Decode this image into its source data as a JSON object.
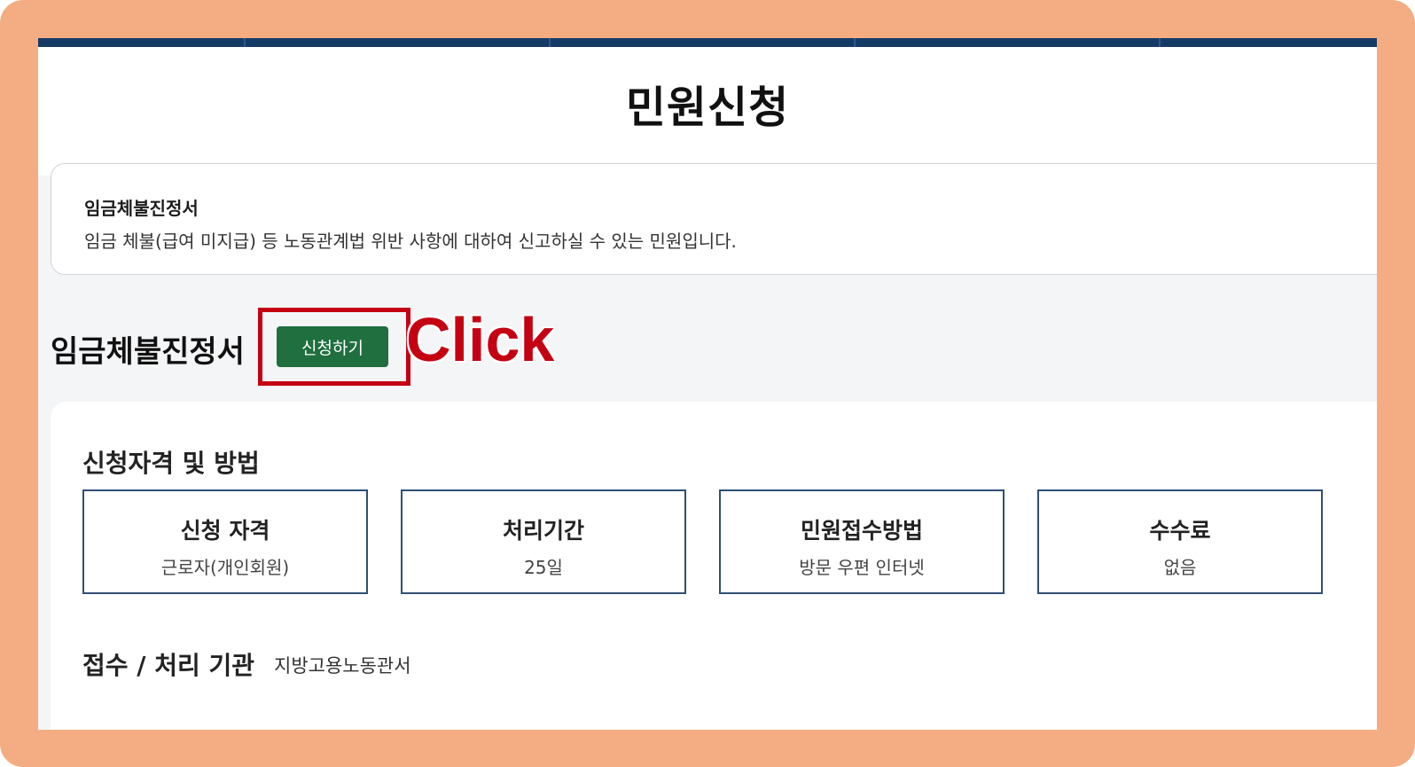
{
  "page": {
    "title": "민원신청"
  },
  "summary": {
    "title": "임금체불진정서",
    "description": "임금 체불(급여 미지급) 등 노동관계법 위반 사항에 대하여 신고하실 수 있는 민원입니다."
  },
  "application": {
    "title": "임금체불진정서",
    "button_label": "신청하기"
  },
  "annotation": {
    "label": "Click",
    "color": "#c40012"
  },
  "details": {
    "heading": "신청자격 및 방법",
    "cards": [
      {
        "label": "신청 자격",
        "value": "근로자(개인회원)"
      },
      {
        "label": "처리기간",
        "value": "25일"
      },
      {
        "label": "민원접수방법",
        "value": "방문 우편 인터넷"
      },
      {
        "label": "수수료",
        "value": "없음"
      }
    ],
    "agency": {
      "label": "접수 / 처리 기관",
      "value": "지방고용노동관서"
    }
  },
  "colors": {
    "frame": "#f4ad82",
    "top_bar": "#163a66",
    "button": "#1f6f3f",
    "card_border": "#2f4f74"
  }
}
